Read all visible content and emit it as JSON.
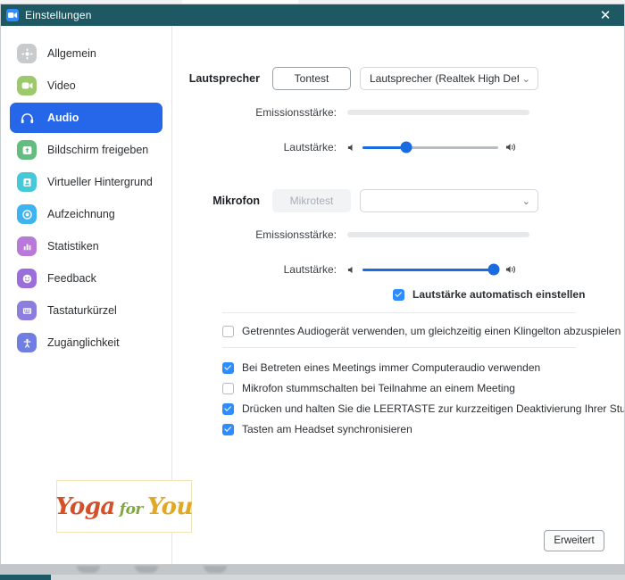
{
  "window": {
    "title": "Einstellungen",
    "app_icon": "video-camera-icon",
    "close_label": "✕",
    "titlebar_color": "#1e5963"
  },
  "sidebar": {
    "items": [
      {
        "label": "Allgemein",
        "icon": "gear-icon",
        "color": "#c8cbce",
        "active": false
      },
      {
        "label": "Video",
        "icon": "video-camera-icon",
        "color": "#9cc96b",
        "active": false
      },
      {
        "label": "Audio",
        "icon": "headphones-icon",
        "color": "#2567e8",
        "active": true
      },
      {
        "label": "Bildschirm freigeben",
        "icon": "screen-share-icon",
        "color": "#63bd7e",
        "active": false
      },
      {
        "label": "Virtueller Hintergrund",
        "icon": "person-card-icon",
        "color": "#45c8d8",
        "active": false
      },
      {
        "label": "Aufzeichnung",
        "icon": "record-circle-icon",
        "color": "#3db4ef",
        "active": false
      },
      {
        "label": "Statistiken",
        "icon": "bar-chart-icon",
        "color": "#b879d8",
        "active": false
      },
      {
        "label": "Feedback",
        "icon": "smiley-face-icon",
        "color": "#9b6fdb",
        "active": false
      },
      {
        "label": "Tastaturkürzel",
        "icon": "keyboard-icon",
        "color": "#8b7ede",
        "active": false
      },
      {
        "label": "Zugänglichkeit",
        "icon": "accessibility-icon",
        "color": "#6f7ee0",
        "active": false
      }
    ]
  },
  "speaker": {
    "section_label": "Lautsprecher",
    "test_button": "Tontest",
    "device": "Lautsprecher (Realtek High Defini...",
    "device_disabled": false,
    "output_level_label": "Emissionsstärke:",
    "output_level_value": 0,
    "volume_label": "Lautstärke:",
    "volume_value": 32
  },
  "microphone": {
    "section_label": "Mikrofon",
    "test_button": "Mikrotest",
    "test_button_disabled": true,
    "device": "",
    "input_level_label": "Emissionsstärke:",
    "input_level_value": 0,
    "volume_label": "Lautstärke:",
    "volume_value": 97,
    "auto_volume_label": "Lautstärke automatisch einstellen",
    "auto_volume_checked": true
  },
  "options": {
    "separate_device": {
      "label": "Getrenntes Audiogerät verwenden, um gleichzeitig einen Klingelton abzuspielen",
      "checked": false
    },
    "list": [
      {
        "label": "Bei Betreten eines Meetings immer Computeraudio verwenden",
        "checked": true
      },
      {
        "label": "Mikrofon stummschalten bei Teilnahme an einem Meeting",
        "checked": false
      },
      {
        "label": "Drücken und halten Sie die LEERTASTE zur kurzzeitigen Deaktivierung Ihrer Stum…",
        "checked": true
      },
      {
        "label": "Tasten am Headset synchronisieren",
        "checked": true
      }
    ]
  },
  "logo": {
    "word1": "Yoga",
    "word2": "for",
    "word3": "You",
    "color1": "#d4502a",
    "color2": "#7fa83c",
    "color3": "#e0a825"
  },
  "footer": {
    "advanced_button": "Erweitert"
  }
}
